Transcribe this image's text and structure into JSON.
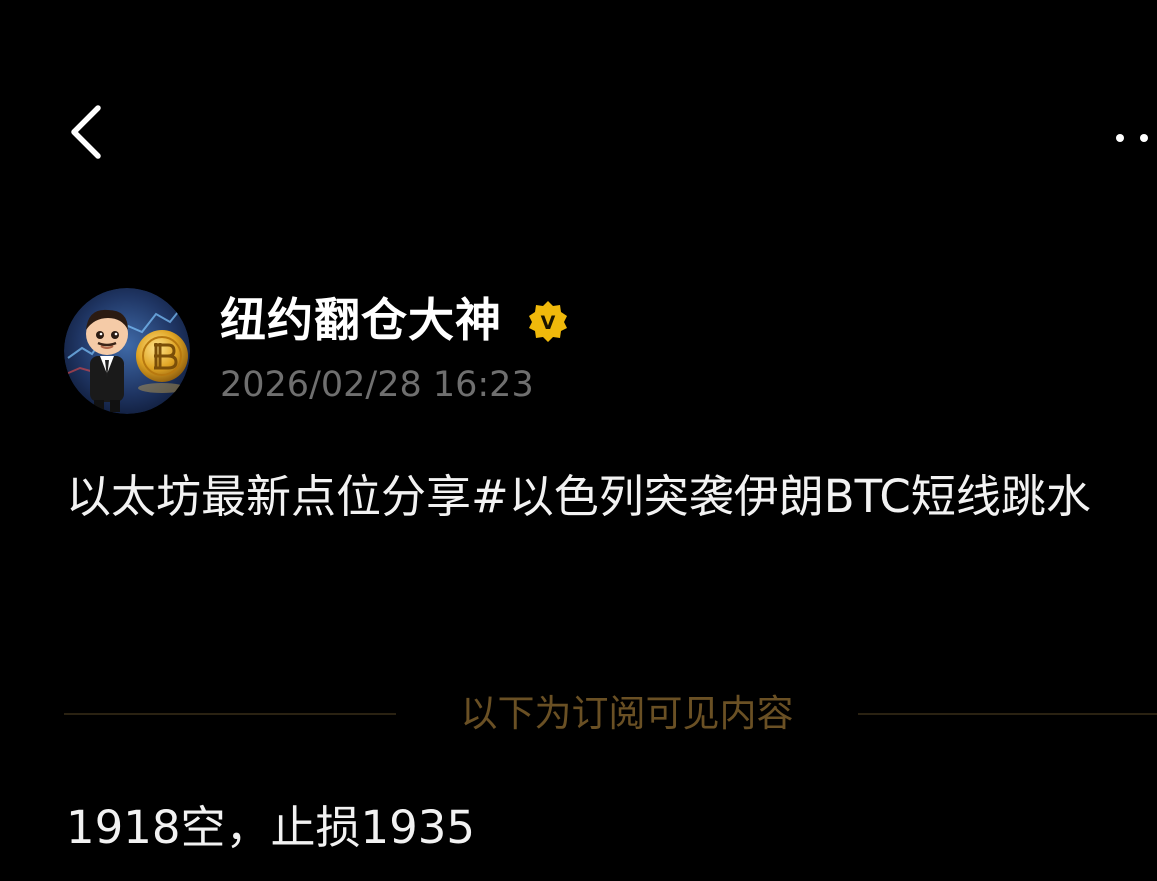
{
  "header": {
    "back_icon": "chevron-left-icon",
    "more_icon": "more-dots-icon"
  },
  "author": {
    "name": "纽约翻仓大神",
    "verified_badge": "V",
    "badge_color": "#f0b90b",
    "avatar_icon": "cartoon-avatar-bitcoin"
  },
  "post": {
    "timestamp": "2026/02/28 16:23",
    "text": "以太坊最新点位分享#以色列突袭伊朗BTC短线跳水"
  },
  "subscription": {
    "divider_label": "以下为订阅可见内容",
    "divider_color": "#6a5024",
    "content_line": "1918空，止损1935"
  }
}
